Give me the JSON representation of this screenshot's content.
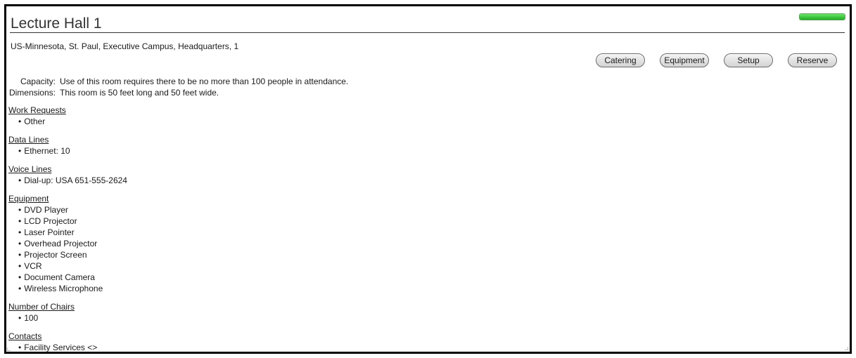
{
  "room": {
    "title": "Lecture Hall 1",
    "location": "US-Minnesota, St. Paul, Executive Campus, Headquarters, 1"
  },
  "status": {
    "progress_fraction": 1.0,
    "color": "#2fc42f"
  },
  "actions": {
    "catering": "Catering",
    "equipment": "Equipment",
    "setup": "Setup",
    "reserve": "Reserve"
  },
  "properties": [
    {
      "label": "Capacity:",
      "value": "Use of this room requires there to be no more than 100 people in attendance."
    },
    {
      "label": "Dimensions:",
      "value": "This room is 50 feet long and 50 feet wide."
    }
  ],
  "sections": [
    {
      "heading": "Work Requests",
      "items": [
        "Other"
      ]
    },
    {
      "heading": "Data Lines",
      "items": [
        "Ethernet: 10"
      ]
    },
    {
      "heading": "Voice Lines",
      "items": [
        "Dial-up: USA 651-555-2624"
      ]
    },
    {
      "heading": "Equipment",
      "items": [
        "DVD Player",
        "LCD Projector",
        "Laser Pointer",
        "Overhead Projector",
        "Projector Screen",
        "VCR",
        "Document Camera",
        "Wireless Microphone"
      ]
    },
    {
      "heading": "Number of Chairs",
      "items": [
        "100"
      ]
    },
    {
      "heading": "Contacts",
      "items": [
        "Facility Services <>"
      ]
    }
  ]
}
